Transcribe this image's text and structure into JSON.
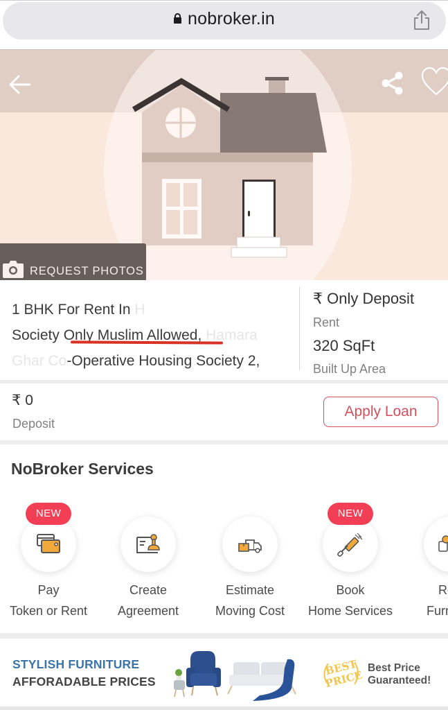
{
  "browser": {
    "url": "nobroker.in",
    "lock_icon": "lock-icon",
    "share_icon": "share-icon"
  },
  "hero": {
    "back_icon": "arrow-left-icon",
    "share_icon": "share-icon",
    "favorite_icon": "heart-icon",
    "request_photos_label": "REQUEST PHOTOS",
    "camera_icon": "camera-icon"
  },
  "listing": {
    "title_line1": "1 BHK For Rent In",
    "title_line1_faded": "H",
    "title_line2_prefix": "Society",
    "title_line2_highlight": "Only Muslim Allowed,",
    "title_line2_faded": "Hamara",
    "title_line3_faded": "Ghar Co",
    "title_line3": "-Operative Housing Society 2,",
    "rent_value": "₹ Only Deposit",
    "rent_label": "Rent",
    "area_value": "320 SqFt",
    "area_label": "Built Up Area"
  },
  "deposit": {
    "value": "₹ 0",
    "label": "Deposit",
    "apply_loan_label": "Apply Loan"
  },
  "services": {
    "title": "NoBroker Services",
    "items": [
      {
        "line1": "Pay",
        "line2": "Token or Rent",
        "badge": "NEW",
        "icon": "wallet-icon"
      },
      {
        "line1": "Create",
        "line2": "Agreement",
        "badge": "",
        "icon": "stamp-agreement-icon"
      },
      {
        "line1": "Estimate",
        "line2": "Moving Cost",
        "badge": "",
        "icon": "moving-truck-icon"
      },
      {
        "line1": "Book",
        "line2": "Home Services",
        "badge": "NEW",
        "icon": "paint-roller-icon"
      },
      {
        "line1": "Rent",
        "line2": "Furniture",
        "badge": "",
        "icon": "furniture-icon"
      }
    ]
  },
  "banner": {
    "line1": "STYLISH FURNITURE",
    "line2": "AFFORADABLE PRICES",
    "badge_text": "BEST PRICE",
    "guarantee_line1": "Best Price",
    "guarantee_line2": "Guaranteed!"
  },
  "colors": {
    "accent_red": "#f23f56",
    "loan_red": "#d3505d",
    "banner_blue": "#3c74a8",
    "highlight_underline": "#d93124"
  }
}
